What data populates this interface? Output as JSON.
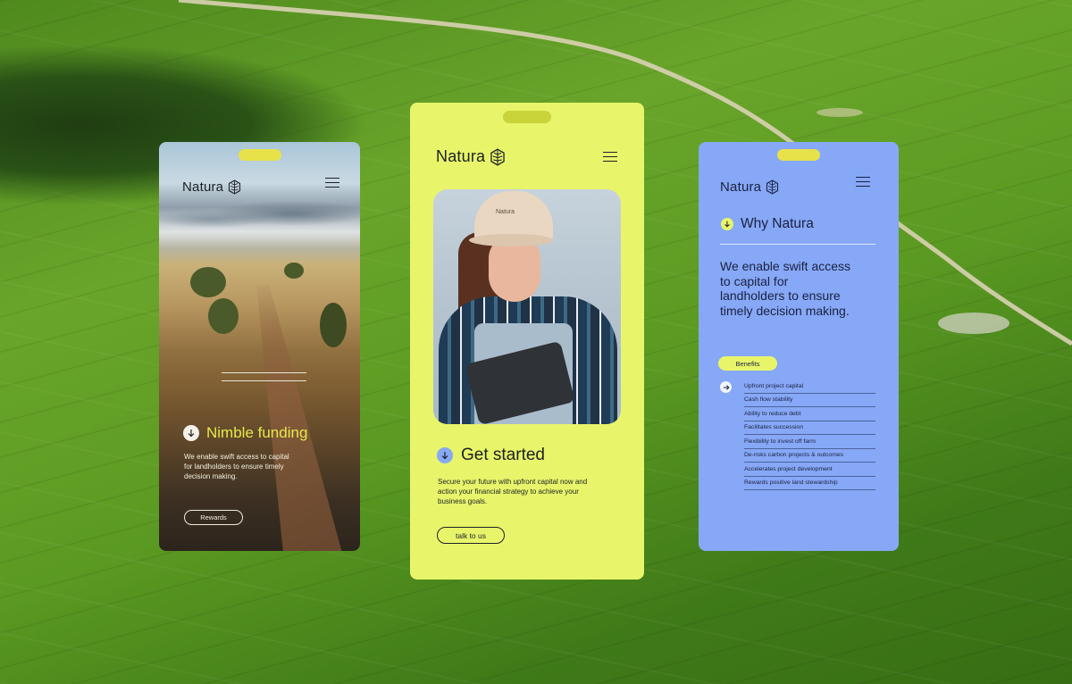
{
  "colors": {
    "field_green": "#5b9a22",
    "lime": "#e8f56a",
    "blue": "#86a8f6"
  },
  "phone_left": {
    "logo": "Natura",
    "logo_icon": "leaf-hexagon-icon",
    "menu_icon": "hamburger-menu-icon",
    "section_icon": "arrow-down-circle-icon",
    "heading": "Nimble funding",
    "body": "We enable swift access to capital for landholders to ensure timely decision making.",
    "button": "Rewards"
  },
  "phone_center": {
    "logo": "Natura",
    "logo_icon": "leaf-hexagon-icon",
    "menu_icon": "hamburger-menu-icon",
    "cap_logo": "Natura",
    "section_icon": "arrow-down-circle-icon",
    "heading": "Get started",
    "body": "Secure your future with upfront capital now and action your financial strategy to achieve your business goals.",
    "button": "talk to us"
  },
  "phone_right": {
    "logo": "Natura",
    "logo_icon": "leaf-hexagon-icon",
    "menu_icon": "hamburger-menu-icon",
    "section_icon": "arrow-down-circle-icon",
    "section_title": "Why Natura",
    "statement": "We enable swift access to capital for landholders to ensure timely decision making.",
    "tag": "Benefits",
    "list_icon": "arrow-right-circle-icon",
    "benefits": [
      "Upfront project capital",
      "Cash flow stability",
      "Ability to reduce debt",
      "Facilitates succession",
      "Flexibility to invest off farm",
      "De-risks carbon projects & outcomes",
      "Accelerates project development",
      "Rewards positive land stewardship"
    ]
  }
}
